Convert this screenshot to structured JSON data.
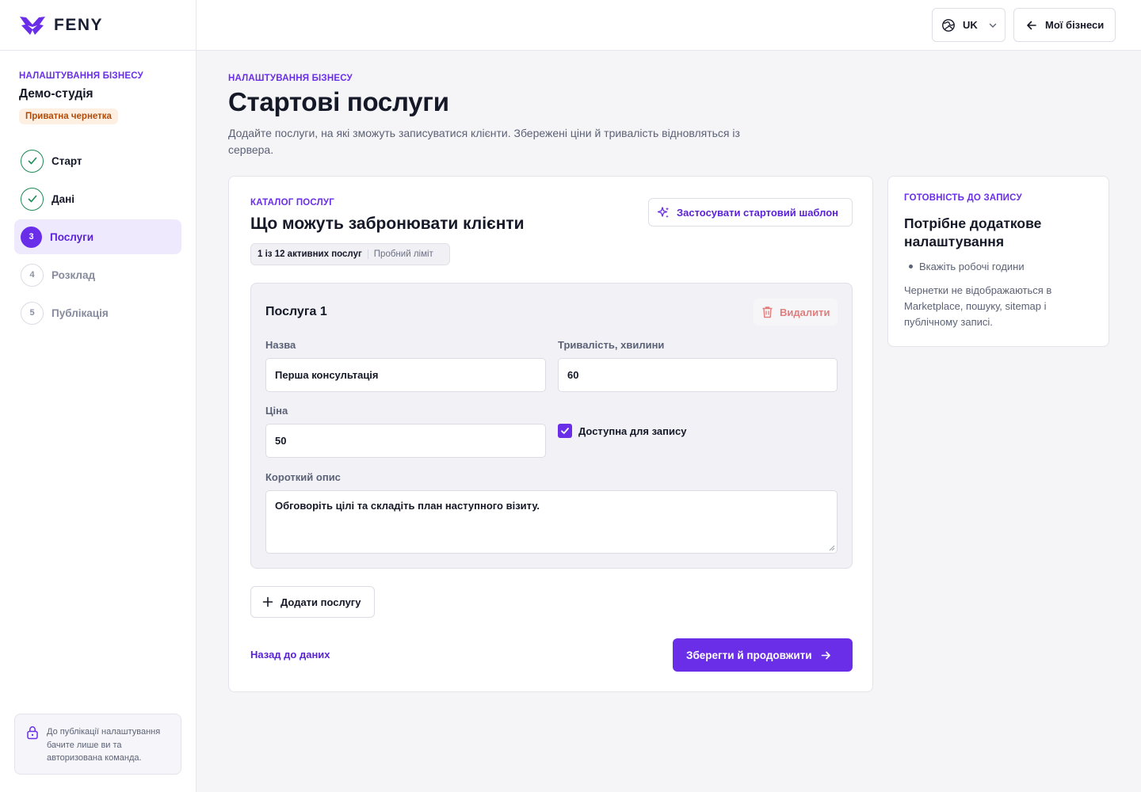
{
  "brand": {
    "name": "FENY",
    "accent": "#6a2ee8"
  },
  "sidebar": {
    "eyebrow": "НАЛАШТУВАННЯ БІЗНЕСУ",
    "business_name": "Демо-студія",
    "draft_badge": "Приватна чернетка",
    "steps": [
      {
        "label": "Старт",
        "state": "done",
        "marker": ""
      },
      {
        "label": "Дані",
        "state": "done",
        "marker": ""
      },
      {
        "label": "Послуги",
        "state": "current",
        "marker": "3"
      },
      {
        "label": "Розклад",
        "state": "todo",
        "marker": "4"
      },
      {
        "label": "Публікація",
        "state": "todo",
        "marker": "5"
      }
    ],
    "privacy_note": "До публікації налаштування бачите лише ви та авторизована команда."
  },
  "topbar": {
    "language": "UK",
    "my_businesses": "Мої бізнеси"
  },
  "header": {
    "eyebrow": "НАЛАШТУВАННЯ БІЗНЕСУ",
    "title": "Стартові послуги",
    "description": "Додайте послуги, на які зможуть записуватися клієнти. Збережені ціни й тривалість відновляться із сервера."
  },
  "catalog": {
    "eyebrow": "КАТАЛОГ ПОСЛУГ",
    "title": "Що можуть забронювати клієнти",
    "apply_template": "Застосувати стартовий шаблон",
    "active_count": "1 із 12 активних послуг",
    "trial_limit": "Пробний ліміт",
    "service": {
      "title": "Послуга 1",
      "delete": "Видалити",
      "name_label": "Назва",
      "name_value": "Перша консультація",
      "duration_label": "Тривалість, хвилини",
      "duration_value": "60",
      "price_label": "Ціна",
      "price_value": "50",
      "available_label": "Доступна для запису",
      "available_checked": true,
      "description_label": "Короткий опис",
      "description_value": "Обговоріть цілі та складіть план наступного візиту."
    },
    "add_service": "Додати послугу",
    "back": "Назад до даних",
    "save": "Зберегти й продовжити"
  },
  "readiness": {
    "eyebrow": "ГОТОВНІСТЬ ДО ЗАПИСУ",
    "title": "Потрібне додаткове налаштування",
    "items": [
      "Вкажіть робочі години"
    ],
    "note": "Чернетки не відображаються в Marketplace, пошуку, sitemap і публічному записі."
  }
}
